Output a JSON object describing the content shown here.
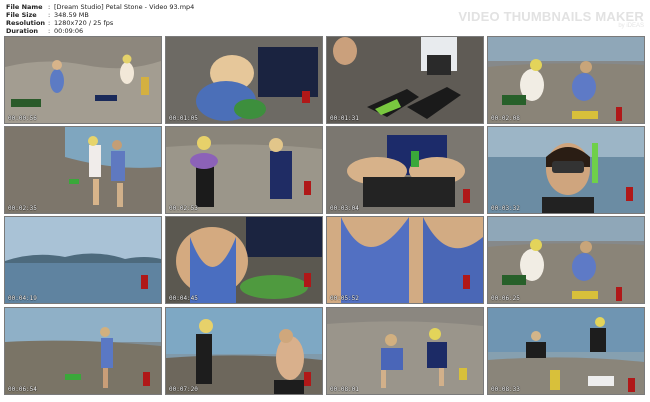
{
  "info": {
    "file_name": {
      "label": "File Name",
      "value": "[Dream Studio] Petal Stone - Video 93.mp4"
    },
    "file_size": {
      "label": "File Size",
      "value": "348.59 MB"
    },
    "resolution": {
      "label": "Resolution",
      "value": "1280x720 / 25 fps"
    },
    "duration": {
      "label": "Duration",
      "value": "00:09:06"
    }
  },
  "brand": {
    "name": "VIDEO THUMBNAILS MAKER",
    "by": "by iDEAS"
  },
  "colors": {
    "background": "#ffffff",
    "sea": "#6f8fa6",
    "rock": "#8f8a80",
    "accent_green": "#3aa83a"
  },
  "thumbnails": [
    {
      "time": "00:00:56",
      "scene": "rocks-two-sitting"
    },
    {
      "time": "00:01:05",
      "scene": "closeup-blonde"
    },
    {
      "time": "00:01:31",
      "scene": "feet-fins-mask"
    },
    {
      "time": "00:02:08",
      "scene": "two-sitting-sea"
    },
    {
      "time": "00:02:35",
      "scene": "two-standing-sea"
    },
    {
      "time": "00:02:53",
      "scene": "wetsuit-standing"
    },
    {
      "time": "00:03:04",
      "scene": "wetsuit-closeup"
    },
    {
      "time": "00:03:32",
      "scene": "mask-snorkel"
    },
    {
      "time": "00:04:19",
      "scene": "sea-mountains"
    },
    {
      "time": "00:04:45",
      "scene": "blue-top-net"
    },
    {
      "time": "00:05:52",
      "scene": "blue-top-closeup"
    },
    {
      "time": "00:06:25",
      "scene": "two-sitting-sea"
    },
    {
      "time": "00:06:54",
      "scene": "standing-rocks-sea"
    },
    {
      "time": "00:07:20",
      "scene": "wetsuit-back"
    },
    {
      "time": "00:08:01",
      "scene": "two-on-rocks"
    },
    {
      "time": "00:08:33",
      "scene": "gear-on-rocks"
    }
  ]
}
